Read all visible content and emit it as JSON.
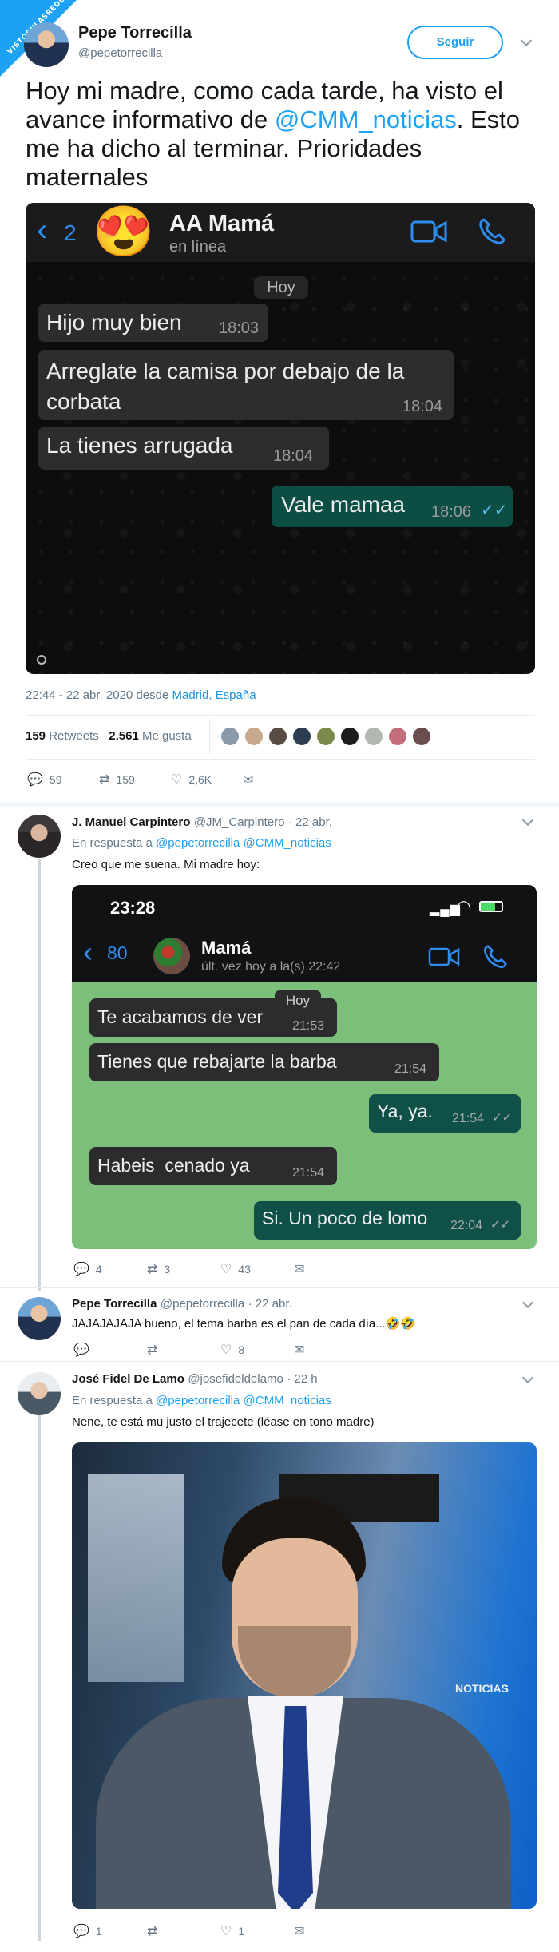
{
  "site_badge": "VISTOENLASREDES.COM",
  "author": {
    "name": "Pepe Torrecilla",
    "handle": "@pepetorrecilla",
    "follow_label": "Seguir"
  },
  "tweet": {
    "text_before": "Hoy mi madre, como cada tarde, ha visto el avance informativo de ",
    "mention": "@CMM_noticias",
    "text_after": ". Esto me ha dicho al terminar. Prioridades maternales"
  },
  "chat1": {
    "back_count": "2",
    "emoji": "😍",
    "contact": "AA Mamá",
    "status": "en línea",
    "day": "Hoy",
    "messages": [
      {
        "text": "Hijo muy bien",
        "time": "18:03",
        "dir": "in"
      },
      {
        "text": "Arreglate la camisa por debajo de la corbata",
        "time": "18:04",
        "dir": "in"
      },
      {
        "text": "La tienes arrugada",
        "time": "18:04",
        "dir": "in"
      },
      {
        "text": "Vale mamaa",
        "time": "18:06",
        "dir": "out"
      }
    ]
  },
  "tweet_meta": {
    "time": "22:44 - 22 abr. 2020 desde ",
    "place": "Madrid, España"
  },
  "stats": {
    "retweets_num": "159",
    "retweets_label": "Retweets",
    "likes_num": "2.561",
    "likes_label": "Me gusta"
  },
  "actions": {
    "replies": "59",
    "retweets": "159",
    "likes": "2,6K"
  },
  "reply1": {
    "name": "J. Manuel Carpintero",
    "handle": "@JM_Carpintero",
    "date": "· 22 abr.",
    "in_reply": "En respuesta a ",
    "mentions": "@pepetorrecilla @CMM_noticias",
    "text": "Creo que me suena. Mi madre hoy:",
    "actions": {
      "replies": "4",
      "retweets": "3",
      "likes": "43"
    }
  },
  "chat2": {
    "clock": "23:28",
    "back_count": "80",
    "contact": "Mamá",
    "status": "últ. vez hoy a la(s) 22:42",
    "day": "Hoy",
    "messages": [
      {
        "text": "Te acabamos de ver",
        "time": "21:53",
        "dir": "in"
      },
      {
        "text": "Tienes que rebajarte la barba",
        "time": "21:54",
        "dir": "in"
      },
      {
        "text": "Ya, ya.",
        "time": "21:54",
        "dir": "out"
      },
      {
        "text": "Habeis  cenado ya",
        "time": "21:54",
        "dir": "in"
      },
      {
        "text": "Si. Un poco de lomo",
        "time": "22:04",
        "dir": "out"
      }
    ]
  },
  "reply2": {
    "name": "Pepe Torrecilla",
    "handle": "@pepetorrecilla",
    "date": "· 22 abr.",
    "text": "JAJAJAJAJA bueno, el tema barba es el pan de cada día...🤣🤣",
    "actions": {
      "likes": "8"
    }
  },
  "reply3": {
    "name": "José Fidel De Lamo",
    "handle": "@josefideldelamo",
    "date": "· 22 h",
    "in_reply": "En respuesta a ",
    "mentions": "@pepetorrecilla @CMM_noticias",
    "text": "Nene, te está mu justo el trajecete (léase en tono madre)",
    "actions": {
      "replies": "1",
      "likes": "1"
    }
  },
  "photo": {
    "screen_text": "NOTICIAS"
  }
}
